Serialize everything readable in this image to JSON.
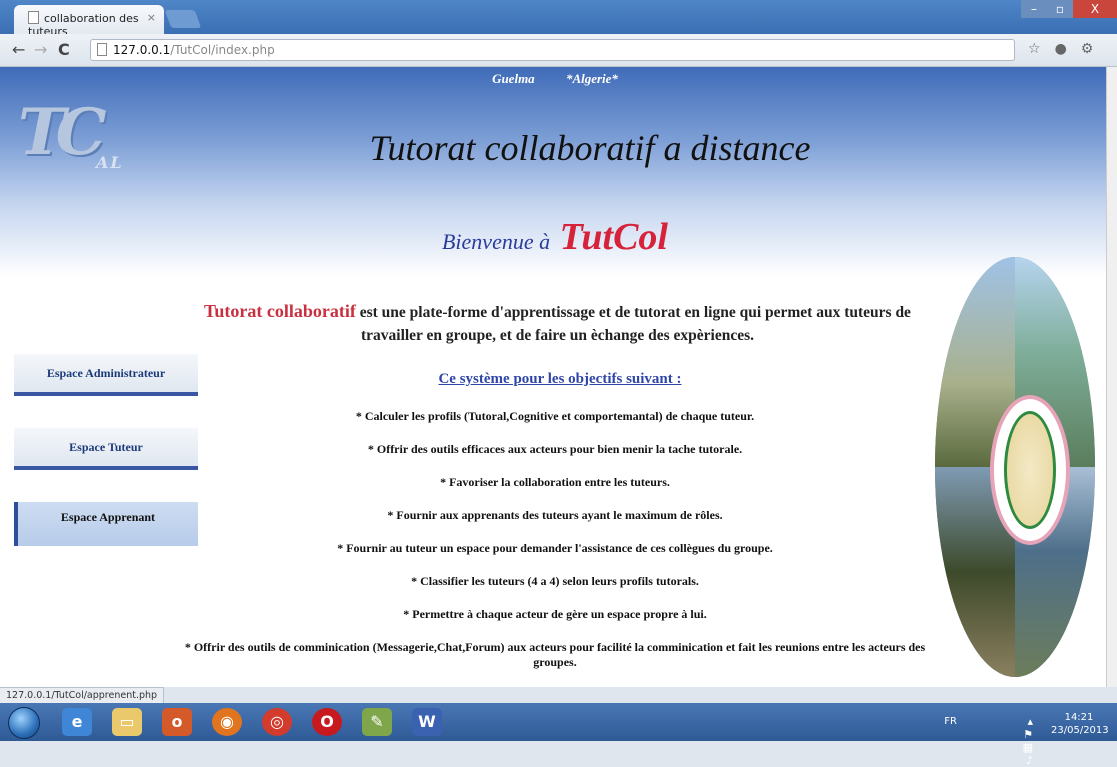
{
  "browser": {
    "tab_title": "collaboration des tuteurs",
    "tab_close": "×",
    "url_host": "127.0.0.1",
    "url_path": "/TutCol/index.php",
    "window_min": "–",
    "window_max": "▫",
    "window_close": "X"
  },
  "header": {
    "city": "Guelma",
    "country": "*Algerie*",
    "logo_text": "TC",
    "logo_sub": "AL",
    "title": "Tutorat collaboratif a distance",
    "welcome_prefix": "Bienvenue à",
    "welcome_brand": "TutCol"
  },
  "intro": {
    "highlight": "Tutorat collaboratif",
    "text": " est une plate-forme d'apprentissage et de tutorat en ligne qui permet aux tuteurs de travailler en groupe, et de faire un èchange des expèriences."
  },
  "objectives": {
    "title": "Ce système pour les objectifs suivant :",
    "items": [
      "* Calculer les profils (Tutoral,Cognitive et comportemantal) de chaque tuteur.",
      "* Offrir des outils efficaces aux acteurs pour bien menir la tache tutorale.",
      "* Favoriser la collaboration entre les tuteurs.",
      "* Fournir aux apprenants des tuteurs ayant le maximum de rôles.",
      "* Fournir au tuteur un espace pour demander l'assistance de ces collègues du groupe.",
      "* Classifier les tuteurs (4 a 4) selon leurs profils tutorals.",
      "* Permettre à chaque acteur de gère un espace propre à lui.",
      "* Offrir des outils de comminication (Messagerie,Chat,Forum) aux acteurs pour facilité la comminication et fait les reunions entre les acteurs des groupes."
    ]
  },
  "sidebar": {
    "items": [
      {
        "label": "Espace Administrateur"
      },
      {
        "label": "Espace Tuteur"
      },
      {
        "label": "Espace Apprenant"
      }
    ]
  },
  "statusbar": {
    "link": "127.0.0.1/TutCol/apprenent.php"
  },
  "taskbar": {
    "lang": "FR",
    "time": "14:21",
    "date": "23/05/2013"
  }
}
